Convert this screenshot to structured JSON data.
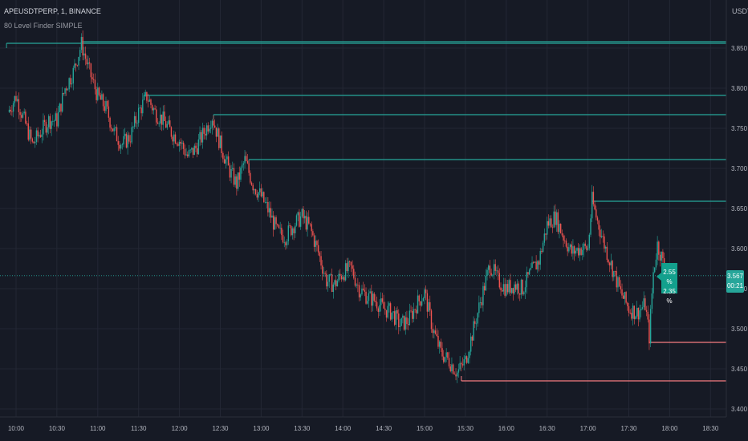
{
  "header": {
    "symbol_line": "APEUSDTPERP, 1, BINANCE",
    "indicator": "80 Level Finder SIMPLE"
  },
  "axis": {
    "unit": "USDT"
  },
  "price_tag": {
    "price": "3.567",
    "countdown": "00:21"
  },
  "pct_tag": {
    "line1": "2.55 %",
    "line2": "2.35 %"
  },
  "colors": {
    "background": "#161a25",
    "grid": "#232734",
    "up": "#26a69a",
    "down": "#ef5350",
    "resistance": "#26a69a",
    "support": "#f77c80"
  },
  "chart_data": {
    "type": "candlestick",
    "ylim": [
      3.39,
      3.92
    ],
    "y_ticks": [
      "3.850",
      "3.800",
      "3.750",
      "3.700",
      "3.650",
      "3.600",
      "3.550",
      "3.500",
      "3.450",
      "3.400"
    ],
    "x_ticks": [
      "10:00",
      "10:30",
      "11:00",
      "11:30",
      "12:00",
      "12:30",
      "13:00",
      "13:30",
      "14:00",
      "14:30",
      "15:00",
      "15:30",
      "16:00",
      "16:30",
      "17:00",
      "17:30",
      "18:00",
      "18:30"
    ],
    "close_price": 3.567,
    "close_path": [
      [
        "09:54",
        3.77
      ],
      [
        "10:00",
        3.79
      ],
      [
        "10:06",
        3.76
      ],
      [
        "10:12",
        3.73
      ],
      [
        "10:18",
        3.745
      ],
      [
        "10:24",
        3.76
      ],
      [
        "10:30",
        3.76
      ],
      [
        "10:36",
        3.8
      ],
      [
        "10:42",
        3.82
      ],
      [
        "10:48",
        3.855
      ],
      [
        "10:54",
        3.82
      ],
      [
        "11:00",
        3.79
      ],
      [
        "11:06",
        3.775
      ],
      [
        "11:12",
        3.745
      ],
      [
        "11:18",
        3.73
      ],
      [
        "11:24",
        3.74
      ],
      [
        "11:30",
        3.77
      ],
      [
        "11:36",
        3.79
      ],
      [
        "11:42",
        3.77
      ],
      [
        "11:48",
        3.76
      ],
      [
        "11:54",
        3.745
      ],
      [
        "12:00",
        3.735
      ],
      [
        "12:06",
        3.715
      ],
      [
        "12:12",
        3.725
      ],
      [
        "12:18",
        3.745
      ],
      [
        "12:24",
        3.765
      ],
      [
        "12:30",
        3.73
      ],
      [
        "12:36",
        3.7
      ],
      [
        "12:42",
        3.68
      ],
      [
        "12:48",
        3.71
      ],
      [
        "12:54",
        3.68
      ],
      [
        "13:00",
        3.665
      ],
      [
        "13:06",
        3.645
      ],
      [
        "13:12",
        3.62
      ],
      [
        "13:18",
        3.615
      ],
      [
        "13:24",
        3.63
      ],
      [
        "13:30",
        3.64
      ],
      [
        "13:36",
        3.625
      ],
      [
        "13:42",
        3.595
      ],
      [
        "13:48",
        3.56
      ],
      [
        "13:54",
        3.555
      ],
      [
        "14:00",
        3.57
      ],
      [
        "14:06",
        3.575
      ],
      [
        "14:12",
        3.55
      ],
      [
        "14:18",
        3.54
      ],
      [
        "14:24",
        3.535
      ],
      [
        "14:30",
        3.525
      ],
      [
        "14:36",
        3.52
      ],
      [
        "14:42",
        3.505
      ],
      [
        "14:48",
        3.51
      ],
      [
        "14:54",
        3.53
      ],
      [
        "15:00",
        3.545
      ],
      [
        "15:06",
        3.5
      ],
      [
        "15:12",
        3.47
      ],
      [
        "15:18",
        3.46
      ],
      [
        "15:24",
        3.445
      ],
      [
        "15:30",
        3.46
      ],
      [
        "15:36",
        3.5
      ],
      [
        "15:42",
        3.54
      ],
      [
        "15:48",
        3.58
      ],
      [
        "15:54",
        3.56
      ],
      [
        "16:00",
        3.55
      ],
      [
        "16:06",
        3.555
      ],
      [
        "16:12",
        3.55
      ],
      [
        "16:18",
        3.57
      ],
      [
        "16:24",
        3.585
      ],
      [
        "16:30",
        3.63
      ],
      [
        "16:36",
        3.64
      ],
      [
        "16:42",
        3.615
      ],
      [
        "16:48",
        3.595
      ],
      [
        "16:54",
        3.6
      ],
      [
        "17:00",
        3.6
      ],
      [
        "17:03",
        3.66
      ],
      [
        "17:06",
        3.64
      ],
      [
        "17:12",
        3.605
      ],
      [
        "17:18",
        3.575
      ],
      [
        "17:24",
        3.545
      ],
      [
        "17:30",
        3.525
      ],
      [
        "17:36",
        3.52
      ],
      [
        "17:42",
        3.53
      ],
      [
        "17:45",
        3.49
      ],
      [
        "17:48",
        3.57
      ],
      [
        "17:51",
        3.605
      ],
      [
        "17:54",
        3.59
      ],
      [
        "17:57",
        3.567
      ]
    ],
    "resistance_levels": [
      {
        "price": 3.858,
        "from": "10:48"
      },
      {
        "price": 3.856,
        "from": "09:53"
      },
      {
        "price": 3.791,
        "from": "11:34"
      },
      {
        "price": 3.767,
        "from": "12:25"
      },
      {
        "price": 3.711,
        "from": "12:51"
      },
      {
        "price": 3.659,
        "from": "17:03"
      }
    ],
    "support_levels": [
      {
        "price": 3.483,
        "from": "17:45"
      },
      {
        "price": 3.435,
        "from": "15:27"
      }
    ]
  }
}
